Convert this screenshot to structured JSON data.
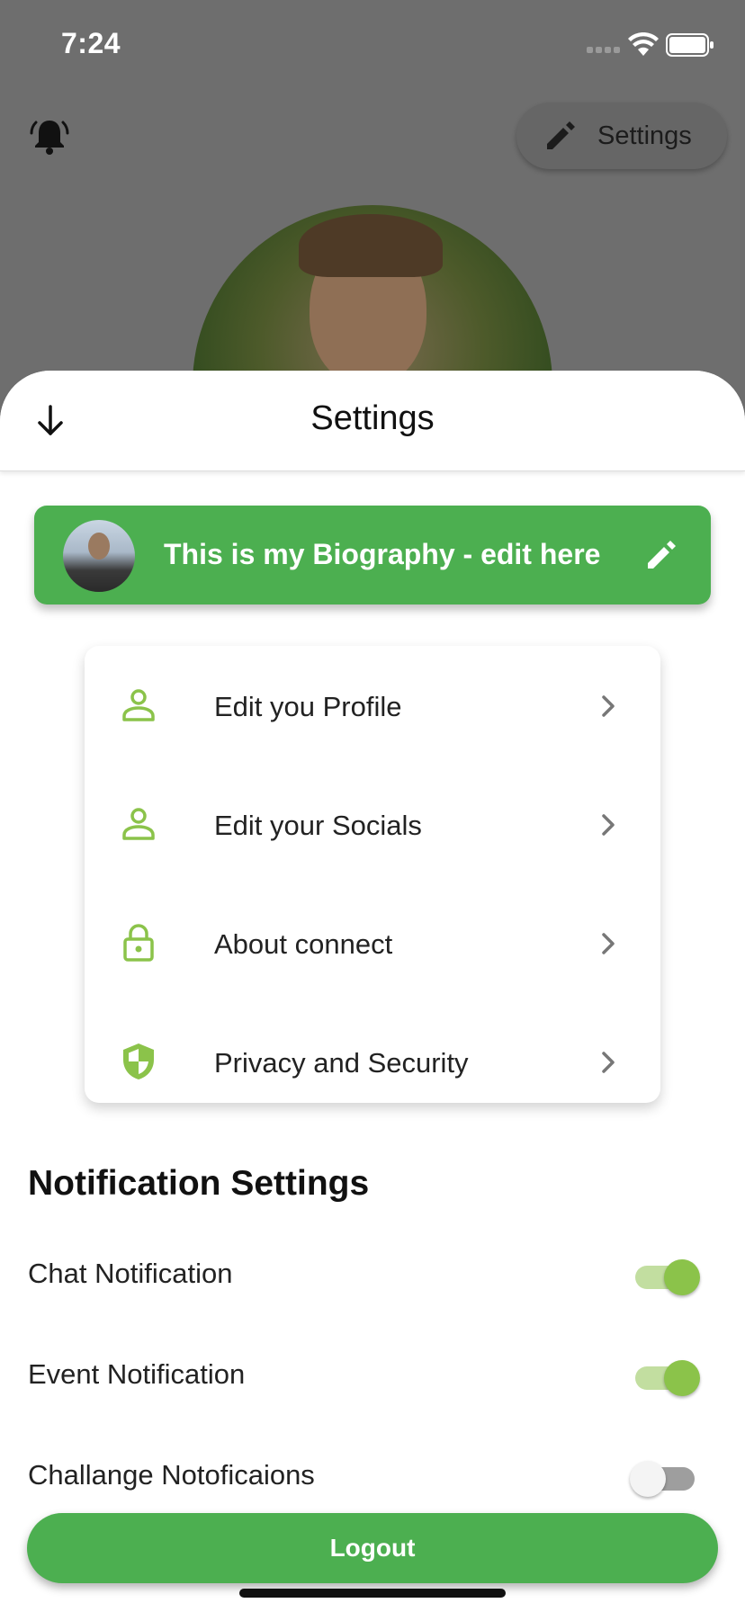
{
  "status_bar": {
    "time": "7:24"
  },
  "header": {
    "settings_chip_label": "Settings",
    "bell_icon": "alarm-bell-icon",
    "pencil_icon": "pencil-icon"
  },
  "sheet": {
    "title": "Settings",
    "back_icon": "arrow-down-icon",
    "bio": {
      "text": "This is my Biography - edit here",
      "edit_icon": "pencil-icon"
    },
    "menu": [
      {
        "label": "Edit you Profile",
        "icon": "person-icon"
      },
      {
        "label": "Edit your Socials",
        "icon": "person-icon"
      },
      {
        "label": "About connect",
        "icon": "lock-icon"
      },
      {
        "label": "Privacy and Security",
        "icon": "shield-icon"
      }
    ],
    "notifications": {
      "heading": "Notification Settings",
      "items": [
        {
          "label": "Chat Notification",
          "enabled": true
        },
        {
          "label": "Event Notification",
          "enabled": true
        },
        {
          "label": "Challange Notoficaions",
          "enabled": false
        }
      ]
    },
    "logout_label": "Logout"
  },
  "colors": {
    "accent_green": "#4caf50",
    "icon_green": "#8bc34a",
    "overlay_gray": "#6e6e6e"
  }
}
